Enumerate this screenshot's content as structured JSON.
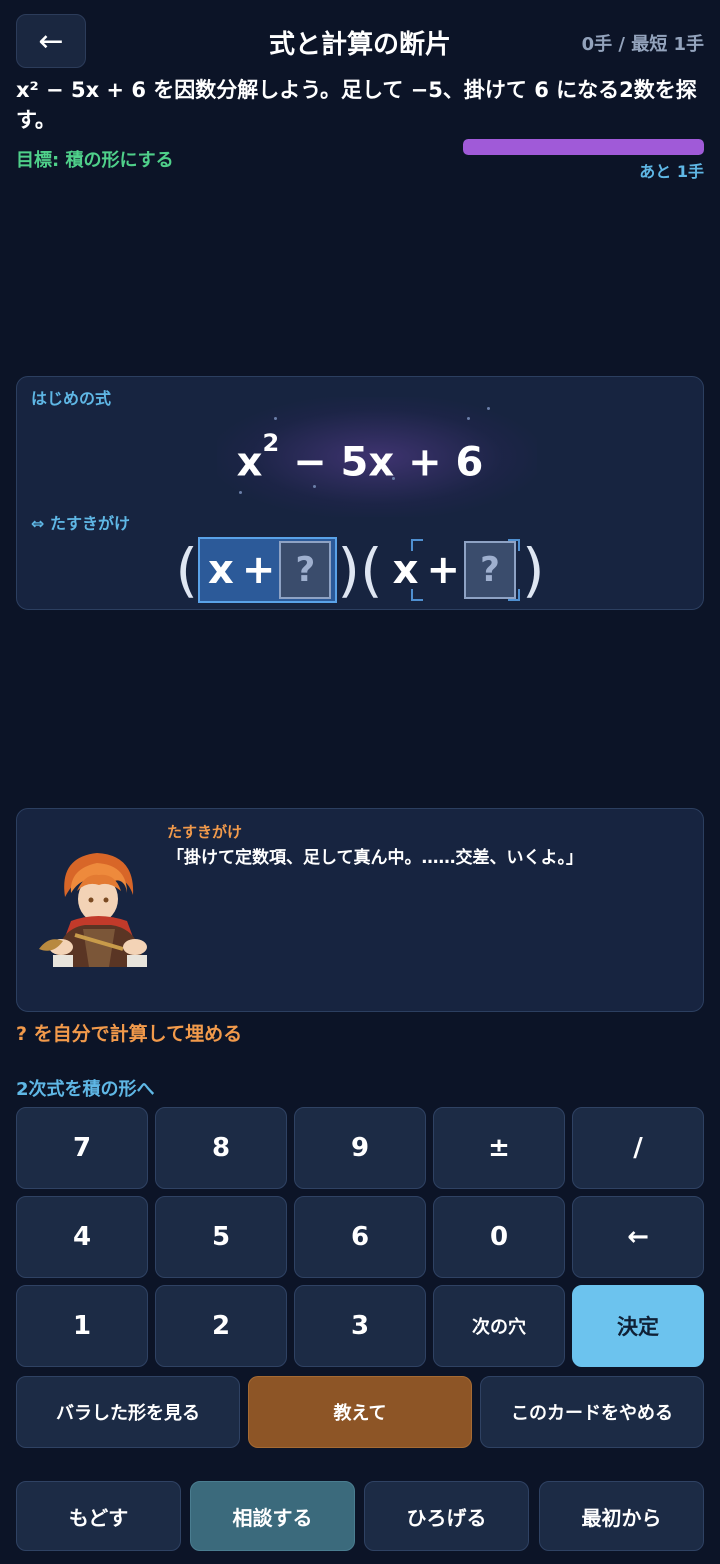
{
  "header": {
    "back_icon": "←",
    "title": "式と計算の断片",
    "moves": "0手 / 最短 1手"
  },
  "problem": {
    "text": "x² − 5x + 6 を因数分解しよう。足して −5、掛けて 6 になる2数を探す。",
    "goal": "目標: 積の形にする",
    "remaining": "あと 1手",
    "progress": 1.0,
    "progress_color": "#a05ad8"
  },
  "expression": {
    "start_label": "はじめの式",
    "start_base": "x",
    "start_exp": "2",
    "start_rest": " − 5x + 6",
    "method_label": "⇔ たすきがけ",
    "left_paren": "(",
    "right_paren": ")",
    "factor1_x": "x",
    "factor1_op": "+",
    "factor1_slot": "?",
    "factor2_x": "x",
    "factor2_op": "+",
    "factor2_slot": "?"
  },
  "dialog": {
    "speaker": "たすきがけ",
    "line": "「掛けて定数項、足して真ん中。……交差、いくよ。」"
  },
  "hint": "? を自分で計算して埋める",
  "keypad": {
    "title": "2次式を積の形へ",
    "keys": [
      "7",
      "8",
      "9",
      "±",
      "/",
      "4",
      "5",
      "6",
      "0",
      "←",
      "1",
      "2",
      "3",
      "次の穴",
      "決定"
    ]
  },
  "actions": {
    "show_expanded": "バラした形を見る",
    "teach": "教えて",
    "quit_card": "このカードをやめる"
  },
  "bottom": {
    "undo": "もどす",
    "consult": "相談する",
    "expand": "ひろげる",
    "restart": "最初から"
  },
  "colors": {
    "background": "#0c1427",
    "accent_blue": "#5fb7e5",
    "accent_orange": "#f29a4b",
    "goal_green": "#4fd08a",
    "confirm": "#6cc3ee",
    "teach": "#8d5526"
  }
}
